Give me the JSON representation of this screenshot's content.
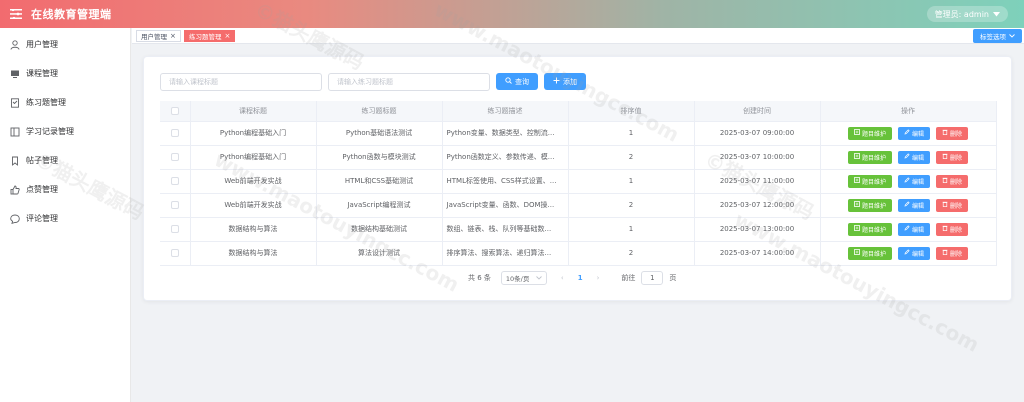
{
  "header": {
    "title": "在线教育管理端",
    "admin_label": "管理员: admin"
  },
  "sidebar": {
    "items": [
      {
        "label": "用户管理",
        "icon": "user-icon"
      },
      {
        "label": "课程管理",
        "icon": "monitor-icon"
      },
      {
        "label": "练习题管理",
        "icon": "document-icon"
      },
      {
        "label": "学习记录管理",
        "icon": "notebook-icon"
      },
      {
        "label": "帖子管理",
        "icon": "bookmark-icon"
      },
      {
        "label": "点赞管理",
        "icon": "thumb-up-icon"
      },
      {
        "label": "评论管理",
        "icon": "chat-icon"
      }
    ]
  },
  "tags": {
    "user_mgmt": "用户管理",
    "exercise_mgmt": "练习题管理",
    "options": "标签选项"
  },
  "search": {
    "course_placeholder": "请输入课程标题",
    "exercise_placeholder": "请输入练习题标题",
    "query_label": "查询",
    "add_label": "添加"
  },
  "table": {
    "columns": [
      "课程标题",
      "练习题标题",
      "练习题描述",
      "排序值",
      "创建时间",
      "操作"
    ],
    "rows": [
      {
        "course": "Python编程基础入门",
        "title": "Python基础语法测试",
        "desc": "Python变量、数据类型、控制流...",
        "sort": "1",
        "time": "2025-03-07 09:00:00"
      },
      {
        "course": "Python编程基础入门",
        "title": "Python函数与模块测试",
        "desc": "Python函数定义、参数传递、模...",
        "sort": "2",
        "time": "2025-03-07 10:00:00"
      },
      {
        "course": "Web前端开发实战",
        "title": "HTML和CSS基础测试",
        "desc": "HTML标签使用、CSS样式设置、...",
        "sort": "1",
        "time": "2025-03-07 11:00:00"
      },
      {
        "course": "Web前端开发实战",
        "title": "JavaScript编程测试",
        "desc": "JavaScript变量、函数、DOM操...",
        "sort": "2",
        "time": "2025-03-07 12:00:00"
      },
      {
        "course": "数据结构与算法",
        "title": "数据结构基础测试",
        "desc": "数组、链表、栈、队列等基础数...",
        "sort": "1",
        "time": "2025-03-07 13:00:00"
      },
      {
        "course": "数据结构与算法",
        "title": "算法设计测试",
        "desc": "排序算法、搜索算法、递归算法...",
        "sort": "2",
        "time": "2025-03-07 14:00:00"
      }
    ],
    "ops": {
      "maintain": "题目维护",
      "edit": "编辑",
      "delete": "删除"
    }
  },
  "pager": {
    "total": "共 6 条",
    "page_size": "10条/页",
    "current": "1",
    "goto_label": "前往",
    "goto_value": "1",
    "unit": "页"
  },
  "watermark": {
    "text1": "©猫头鹰源码",
    "text2": "www.maotouyingcc.com"
  }
}
